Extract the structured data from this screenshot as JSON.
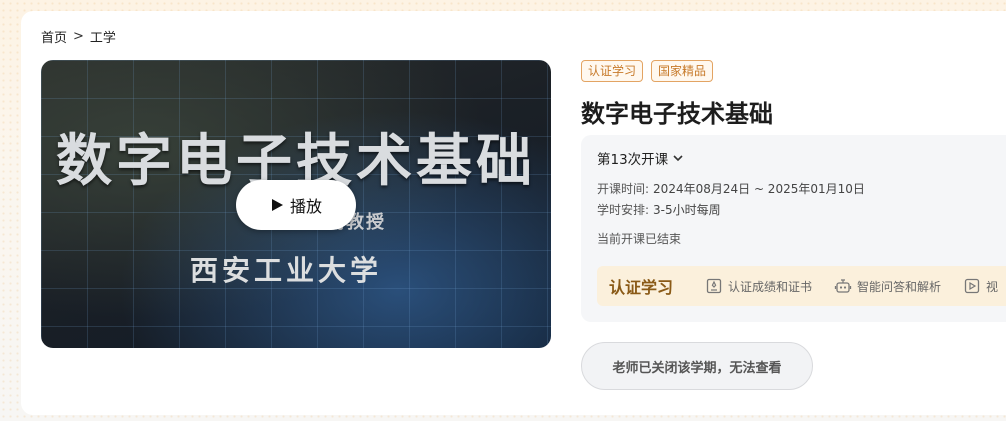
{
  "breadcrumb": {
    "home": "首页",
    "separator": ">",
    "current": "工学"
  },
  "video": {
    "headline": "数字电子技术基础",
    "teacher_line": "副教授",
    "school": "西安工业大学",
    "play_label": "播放"
  },
  "course": {
    "tags": [
      "认证学习",
      "国家精品"
    ],
    "title": "数字电子技术基础",
    "term": "第13次开课",
    "open_time_label": "开课时间:",
    "open_time_value": "2024年08月24日 ~ 2025年01月10日",
    "schedule_label": "学时安排:",
    "schedule_value": "3-5小时每周",
    "status": "当前开课已结束",
    "cert_title": "认证学习",
    "cert_items": [
      "认证成绩和证书",
      "智能问答和解析",
      "视"
    ],
    "closed_button": "老师已关闭该学期，无法查看"
  },
  "colors": {
    "accent": "#c77a2a",
    "cert_bg": "#fbf0dc",
    "cert_text": "#8a5a17"
  },
  "icons": [
    "play-icon",
    "chevron-down-icon",
    "certificate-icon",
    "robot-icon",
    "video-icon"
  ]
}
